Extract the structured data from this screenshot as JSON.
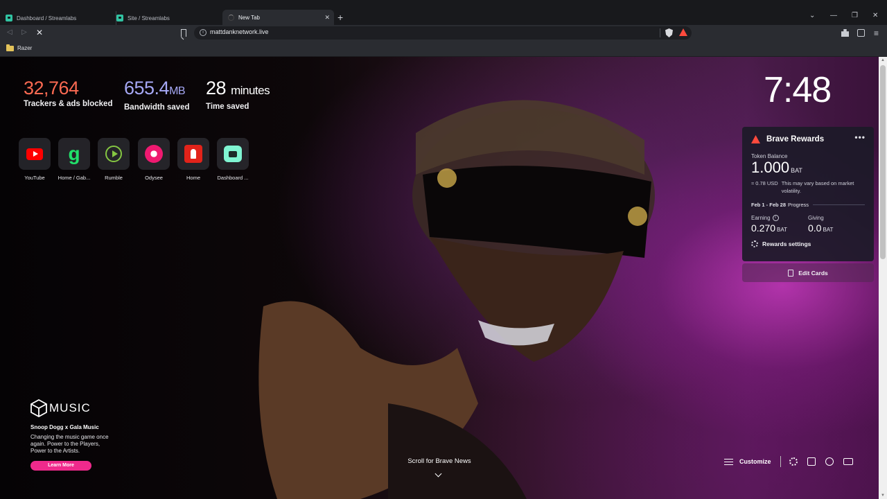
{
  "browser": {
    "tabs": [
      {
        "title": "Dashboard / Streamlabs"
      },
      {
        "title": "Site / Streamlabs"
      },
      {
        "title": "New Tab"
      }
    ],
    "new_tab_glyph": "+",
    "window_controls": {
      "chevron": "⌄",
      "minimize": "—",
      "restore": "❐",
      "close": "✕"
    },
    "nav": {
      "back": "◁",
      "forward": "▷",
      "stop": "✕"
    },
    "url": "mattdanknetwork.live",
    "menu_glyph": "≡",
    "bookmarks": [
      {
        "label": "Razer"
      }
    ]
  },
  "stats": {
    "trackers": {
      "value": "32,764",
      "label": "Trackers & ads blocked"
    },
    "bandwidth": {
      "value": "655.4",
      "unit": "MB",
      "label": "Bandwidth saved"
    },
    "time": {
      "value": "28",
      "unit": "minutes",
      "label": "Time saved"
    }
  },
  "top_sites": [
    {
      "name": "YouTube",
      "icon": "youtube-icon"
    },
    {
      "name": "Home / Gab...",
      "icon": "gab-icon"
    },
    {
      "name": "Rumble",
      "icon": "rumble-icon"
    },
    {
      "name": "Odysee",
      "icon": "odysee-icon"
    },
    {
      "name": "Home",
      "icon": "home-icon"
    },
    {
      "name": "Dashboard ...",
      "icon": "streamlabs-icon"
    }
  ],
  "clock": "7:48",
  "rewards": {
    "title": "Brave Rewards",
    "more": "•••",
    "token_balance_label": "Token Balance",
    "balance": "1.000",
    "balance_unit": "BAT",
    "usd": "≈ 0.78 USD",
    "volatility_note": "This may vary based on market volatility.",
    "period": "Feb 1 - Feb 28",
    "progress_label": "Progress",
    "earning_label": "Earning",
    "earning": "0.270",
    "giving_label": "Giving",
    "giving": "0.0",
    "unit": "BAT",
    "settings_label": "Rewards settings",
    "edit_cards_label": "Edit Cards"
  },
  "sponsor": {
    "brand": "MUSIC",
    "title": "Snoop Dogg x Gala Music",
    "description": "Changing the music game once again. Power to the Players, Power to the Artists.",
    "button": "Learn More"
  },
  "footer": {
    "scroll_news": "Scroll for Brave News",
    "customize": "Customize"
  },
  "colors": {
    "trackers": "#fb6a52",
    "bandwidth": "#a6a8f5",
    "accent_pink": "#ef2a8c",
    "brave_orange": "#ff4a3d"
  }
}
